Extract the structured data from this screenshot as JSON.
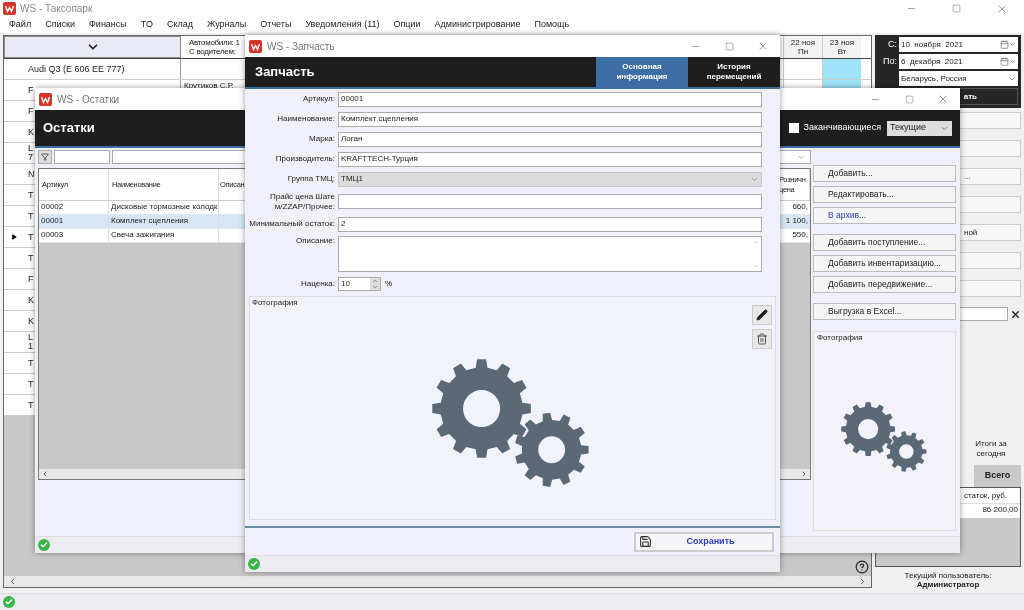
{
  "app": {
    "title": "WS - Таксопарк",
    "menu": [
      "Файл",
      "Списки",
      "Финансы",
      "ТО",
      "Склад",
      "Журналы",
      "Отчеты",
      "Уведомления (11)",
      "Опции",
      "Администрирование",
      "Помощь"
    ]
  },
  "schedule": {
    "summary": [
      "Автомобили: 1",
      "С водителем:"
    ],
    "days": [
      {
        "date": "22 ноя",
        "weekday": "Пн",
        "selected": false
      },
      {
        "date": "23 ноя",
        "weekday": "Вт",
        "selected": true
      }
    ],
    "cars": [
      {
        "lines": [
          "Audi Q3 (E 606 EE 777)"
        ],
        "current": false
      },
      {
        "lines": [
          "F"
        ],
        "current": false,
        "driver": "Крутиков С.Р."
      },
      {
        "lines": [
          "F"
        ],
        "current": false
      },
      {
        "lines": [
          "K"
        ],
        "current": false
      },
      {
        "lines": [
          "L",
          "7"
        ],
        "current": false
      },
      {
        "lines": [
          "N"
        ],
        "current": false
      },
      {
        "lines": [
          "T"
        ],
        "current": false
      },
      {
        "lines": [
          "T"
        ],
        "current": false
      },
      {
        "lines": [
          "T"
        ],
        "current": true
      },
      {
        "lines": [
          "T"
        ],
        "current": false
      },
      {
        "lines": [
          "F"
        ],
        "current": false
      },
      {
        "lines": [
          "K"
        ],
        "current": false
      },
      {
        "lines": [
          "K"
        ],
        "current": false
      },
      {
        "lines": [
          "L",
          "1"
        ],
        "current": false
      },
      {
        "lines": [
          "T"
        ],
        "current": false
      },
      {
        "lines": [
          "T"
        ],
        "current": false
      },
      {
        "lines": [
          "T"
        ],
        "current": false
      }
    ]
  },
  "filter": {
    "from_label": "С:",
    "from": "10  ноября  2021",
    "to_label": "По:",
    "to": "6  декабря  2021",
    "region": "Беларусь, Россия",
    "apply": "ать"
  },
  "side": {
    "buttons": [
      "...",
      "ной"
    ],
    "totals_label": "Итоги за сегодня",
    "totals_tab": "Всего",
    "totals_header": "статок, руб.",
    "totals_value": "86 200,00",
    "user_label": "Текущий пользователь:",
    "user": "Администратор"
  },
  "stock_window": {
    "title": "WS - Остатки",
    "heading": "Остатки",
    "low_stock": {
      "label": "Заканчивающиеся",
      "checked": false
    },
    "mode": "Текущие",
    "columns": [
      "Артикул",
      "Наименование",
      "Описан",
      "Розничн цена"
    ],
    "rows": [
      {
        "article": "00002",
        "name": "Дисковые тормозные колодк",
        "price": "660,",
        "selected": false
      },
      {
        "article": "00001",
        "name": "Комплект сцепления",
        "price": "1 100,",
        "selected": true
      },
      {
        "article": "00003",
        "name": "Свеча зажигания",
        "price": "550,",
        "selected": false
      }
    ],
    "actions": [
      [
        {
          "label": "Добавить...",
          "kind": "button"
        },
        {
          "label": "Редактировать...",
          "kind": "button"
        },
        {
          "label": "В архив...",
          "kind": "link"
        }
      ],
      [
        {
          "label": "Добавить поступление...",
          "kind": "button"
        },
        {
          "label": "Добавить инвентаризацию...",
          "kind": "button"
        },
        {
          "label": "Добавить передвижение...",
          "kind": "button"
        }
      ],
      [
        {
          "label": "Выгрузка в Excel...",
          "kind": "button"
        }
      ]
    ],
    "photo_label": "Фотография"
  },
  "part_window": {
    "title": "WS - Запчасть",
    "heading": "Запчасть",
    "tabs": [
      {
        "label": "Основная информация",
        "selected": true
      },
      {
        "label": "История перемещений",
        "selected": false
      }
    ],
    "fields": [
      {
        "label": "Артикул:",
        "value": "00001",
        "kind": "text"
      },
      {
        "label": "Наименование:",
        "value": "Комплект сцепления",
        "kind": "text"
      },
      {
        "label": "Марка:",
        "value": "Логан",
        "kind": "text"
      },
      {
        "label": "Производитель:",
        "value": "KRAFTTECH-Турция",
        "kind": "text"
      },
      {
        "label": "Группа ТМЦ:",
        "value": "ТМЦ1",
        "kind": "select"
      },
      {
        "label": "Прайс цена Шате м/ZZAP/Прочее:",
        "kind": "text"
      },
      {
        "label": "Минимальный остаток:",
        "value": "2",
        "kind": "text"
      },
      {
        "label": "Описание:",
        "kind": "textarea"
      },
      {
        "label": "Наценка:",
        "value": "10",
        "unit": "%",
        "kind": "spinner"
      }
    ],
    "photo_label": "Фотография",
    "save": "Сохранить"
  }
}
